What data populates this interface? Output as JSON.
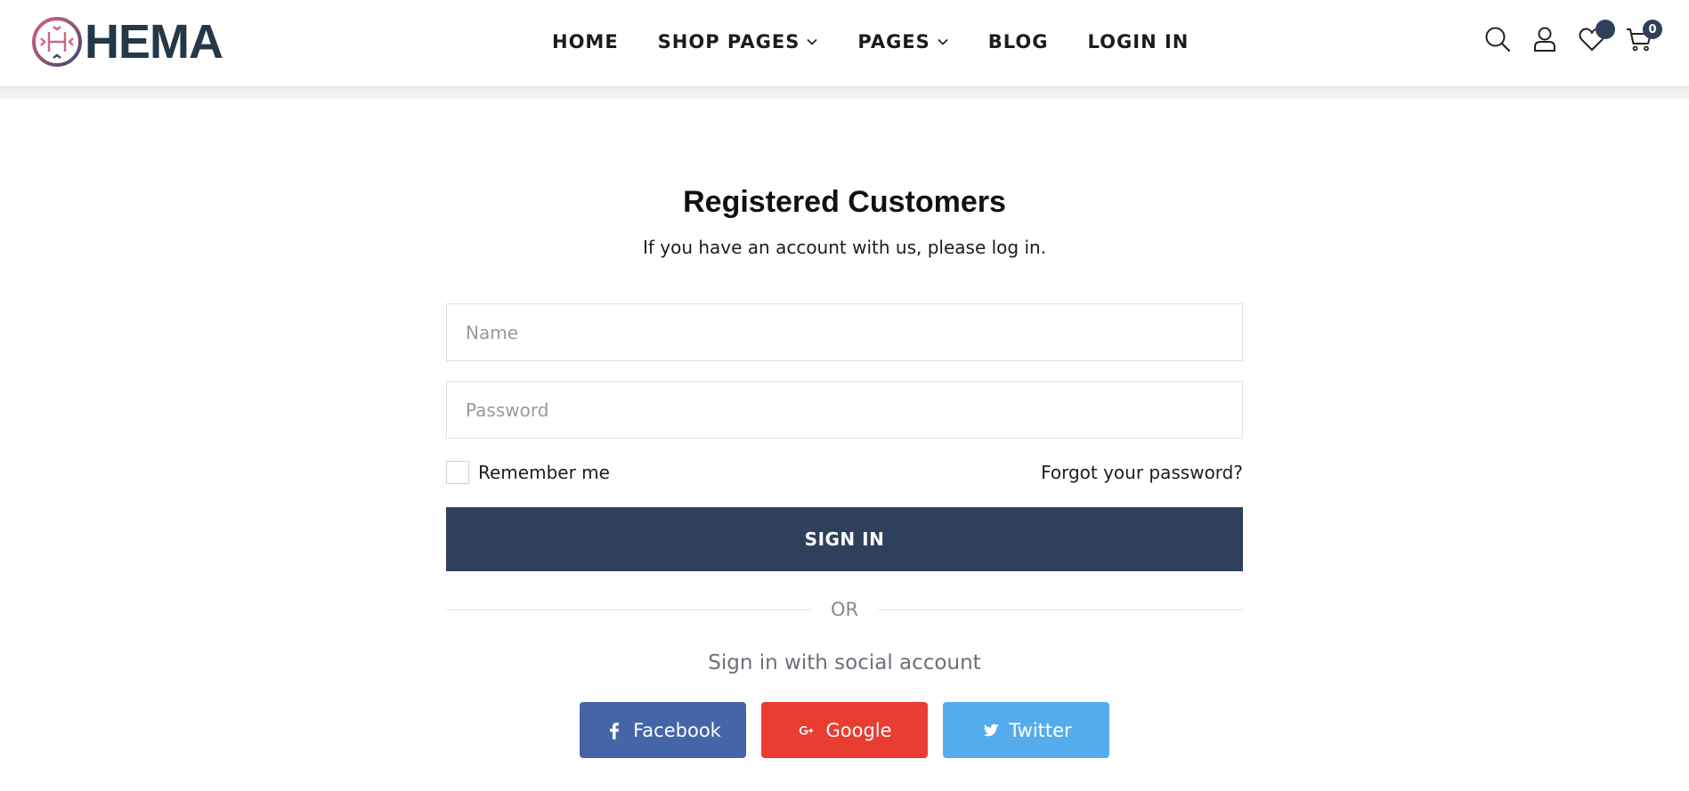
{
  "brand": {
    "name": "HEMA",
    "logo_icon": "hema-h-logo-mark",
    "primary_color": "#2f405d",
    "logo_text_color": "#233848"
  },
  "nav": {
    "items": [
      {
        "label": "HOME",
        "has_dropdown": false
      },
      {
        "label": "SHOP PAGES",
        "has_dropdown": true
      },
      {
        "label": "PAGES",
        "has_dropdown": true
      },
      {
        "label": "BLOG",
        "has_dropdown": false
      },
      {
        "label": "LOGIN IN",
        "has_dropdown": false
      }
    ]
  },
  "header_icons": {
    "search": "search-icon",
    "account": "user-icon",
    "wishlist": {
      "icon": "heart-icon",
      "badge": ""
    },
    "cart": {
      "icon": "cart-icon",
      "badge": "0"
    }
  },
  "login": {
    "title": "Registered Customers",
    "subtitle": "If you have an account with us, please log in.",
    "name_placeholder": "Name",
    "password_placeholder": "Password",
    "remember_label": "Remember me",
    "remember_checked": false,
    "forgot_label": "Forgot your password?",
    "signin_label": "SIGN IN",
    "or_label": "OR",
    "social_text": "Sign in with social account",
    "social": [
      {
        "label": "Facebook",
        "icon": "facebook-icon",
        "color": "#4565a8"
      },
      {
        "label": "Google",
        "icon": "google-plus-icon",
        "color": "#e93d32"
      },
      {
        "label": "Twitter",
        "icon": "twitter-icon",
        "color": "#54acec"
      }
    ]
  }
}
